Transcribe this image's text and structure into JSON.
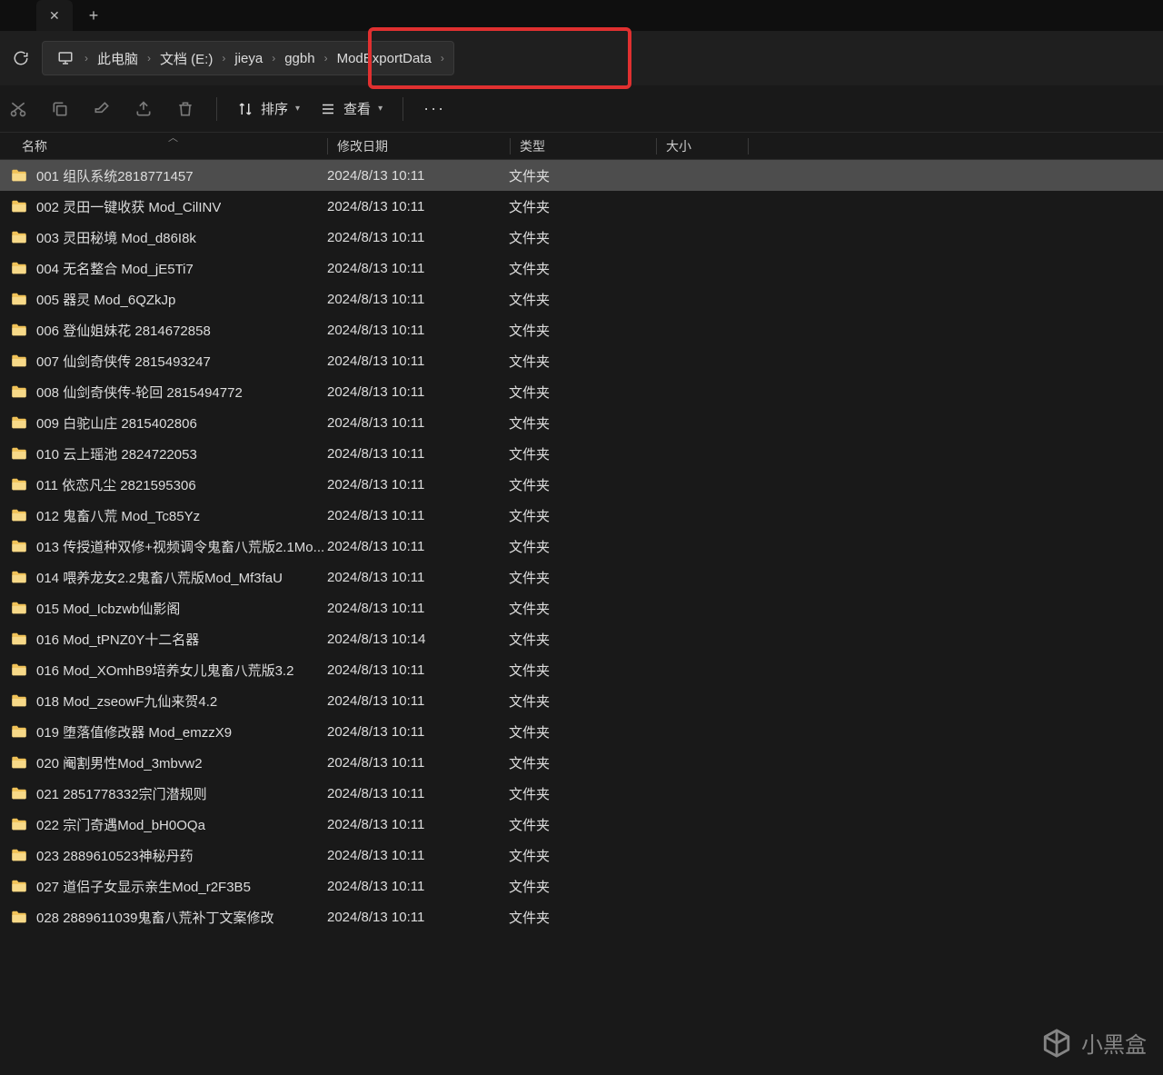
{
  "tab": {
    "close_glyph": "✕",
    "new_tab_glyph": "+"
  },
  "nav": {
    "refresh_glyph": "⟳",
    "monitor_glyph": "🖥"
  },
  "breadcrumb": {
    "items": [
      {
        "label": "此电脑"
      },
      {
        "label": "文档 (E:)"
      },
      {
        "label": "jieya"
      },
      {
        "label": "ggbh"
      },
      {
        "label": "ModExportData"
      }
    ],
    "sep": "›"
  },
  "toolbar": {
    "sort_label": "排序",
    "view_label": "查看",
    "more_glyph": "···"
  },
  "columns": {
    "name": "名称",
    "date": "修改日期",
    "type": "类型",
    "size": "大小",
    "sort_indicator": "︿"
  },
  "type_folder": "文件夹",
  "files": [
    {
      "name": "001 组队系统2818771457",
      "date": "2024/8/13 10:11",
      "selected": true
    },
    {
      "name": "002 灵田一键收获 Mod_CilINV",
      "date": "2024/8/13 10:11"
    },
    {
      "name": "003 灵田秘境 Mod_d86I8k",
      "date": "2024/8/13 10:11"
    },
    {
      "name": "004 无名整合 Mod_jE5Ti7",
      "date": "2024/8/13 10:11"
    },
    {
      "name": "005 器灵 Mod_6QZkJp",
      "date": "2024/8/13 10:11"
    },
    {
      "name": "006 登仙姐妹花 2814672858",
      "date": "2024/8/13 10:11"
    },
    {
      "name": "007 仙剑奇侠传 2815493247",
      "date": "2024/8/13 10:11"
    },
    {
      "name": "008 仙剑奇侠传-轮回 2815494772",
      "date": "2024/8/13 10:11"
    },
    {
      "name": "009 白驼山庄 2815402806",
      "date": "2024/8/13 10:11"
    },
    {
      "name": "010 云上瑶池 2824722053",
      "date": "2024/8/13 10:11"
    },
    {
      "name": "011 依恋凡尘 2821595306",
      "date": "2024/8/13 10:11"
    },
    {
      "name": "012 鬼畜八荒 Mod_Tc85Yz",
      "date": "2024/8/13 10:11"
    },
    {
      "name": "013 传授道种双修+视频调令鬼畜八荒版2.1Mo...",
      "date": "2024/8/13 10:11"
    },
    {
      "name": "014 喂养龙女2.2鬼畜八荒版Mod_Mf3faU",
      "date": "2024/8/13 10:11"
    },
    {
      "name": "015 Mod_Icbzwb仙影阁",
      "date": "2024/8/13 10:11"
    },
    {
      "name": "016 Mod_tPNZ0Y十二名器",
      "date": "2024/8/13 10:14"
    },
    {
      "name": "016 Mod_XOmhB9培养女儿鬼畜八荒版3.2",
      "date": "2024/8/13 10:11"
    },
    {
      "name": "018 Mod_zseowF九仙来贺4.2",
      "date": "2024/8/13 10:11"
    },
    {
      "name": "019 堕落值修改器 Mod_emzzX9",
      "date": "2024/8/13 10:11"
    },
    {
      "name": "020 阉割男性Mod_3mbvw2",
      "date": "2024/8/13 10:11"
    },
    {
      "name": "021 2851778332宗门潜规则",
      "date": "2024/8/13 10:11"
    },
    {
      "name": "022 宗门奇遇Mod_bH0OQa",
      "date": "2024/8/13 10:11"
    },
    {
      "name": "023 2889610523神秘丹药",
      "date": "2024/8/13 10:11"
    },
    {
      "name": "027 道侣子女显示亲生Mod_r2F3B5",
      "date": "2024/8/13 10:11"
    },
    {
      "name": "028 2889611039鬼畜八荒补丁文案修改",
      "date": "2024/8/13 10:11"
    }
  ],
  "watermark": {
    "text": "小黑盒"
  }
}
